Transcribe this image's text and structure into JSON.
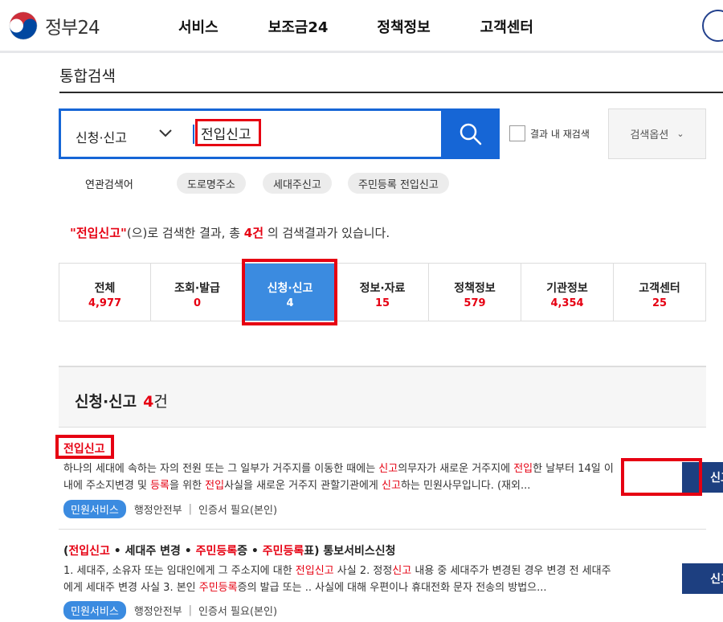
{
  "header": {
    "logo_text": "정부24",
    "nav": [
      "서비스",
      "보조금24",
      "정책정보",
      "고객센터"
    ]
  },
  "page_title": "통합검색",
  "search": {
    "category": "신청·신고",
    "query": "전입신고",
    "rescan_label": "결과 내 재검색",
    "options_label": "검색옵션"
  },
  "related": {
    "label": "연관검색어",
    "chips": [
      "도로명주소",
      "세대주신고",
      "주민등록 전입신고"
    ]
  },
  "summary": {
    "keyword": "\"전입신고\"",
    "pre": "(으)로 검색한 결과, 총 ",
    "count": "4건",
    "post": " 의 검색결과가 있습니다."
  },
  "tabs": [
    {
      "label": "전체",
      "count": "4,977"
    },
    {
      "label": "조회·발급",
      "count": "0"
    },
    {
      "label": "신청·신고",
      "count": "4"
    },
    {
      "label": "정보·자료",
      "count": "15"
    },
    {
      "label": "정책정보",
      "count": "579"
    },
    {
      "label": "기관정보",
      "count": "4,354"
    },
    {
      "label": "고객센터",
      "count": "25"
    }
  ],
  "section": {
    "title": "신청·신고",
    "count": "4",
    "unit": "건"
  },
  "results": [
    {
      "title": "전입신고",
      "desc_parts": [
        "하나의 세대에 속하는 자의 전원 또는 그 일부가 거주지를 이동한 때에는 ",
        "신고",
        "의무자가 새로운 거주지에 ",
        "전입",
        "한 날부터 14일 이내에 주소지변경 및 ",
        "등록",
        "을 위한 ",
        "전입",
        "사실을 새로운 거주지 관할기관에게 ",
        "신고",
        "하는 민원사무입니다. (재외..."
      ],
      "badge": "민원서비스",
      "org": "행정안전부",
      "cert": "인증서 필요(본인)",
      "button": "신고"
    },
    {
      "title_parts": [
        "(",
        "전입신고",
        " • 세대주 변경 • ",
        "주민등록",
        "증 • ",
        "주민등록",
        "표) 통보서비스신청"
      ],
      "desc_parts": [
        "1. 세대주, 소유자 또는 임대인에게 그 주소지에 대한 ",
        "전입신고",
        " 사실 2. 정정",
        "신고",
        " 내용 중 세대주가 변경된 경우 변경 전 세대주에게 세대주 변경 사실 3. 본인 ",
        "주민등록",
        "증의 발급 또는 .. 사실에 대해 우편이나 휴대전화 문자 전송의 방법으..."
      ],
      "badge": "민원서비스",
      "org": "행정안전부",
      "cert": "인증서 필요(본인)",
      "button": "신고"
    }
  ],
  "colors": {
    "brand_blue": "#1666d6",
    "active_tab": "#3b8be0",
    "button_navy": "#1d3f80",
    "highlight_red": "#e60012"
  }
}
